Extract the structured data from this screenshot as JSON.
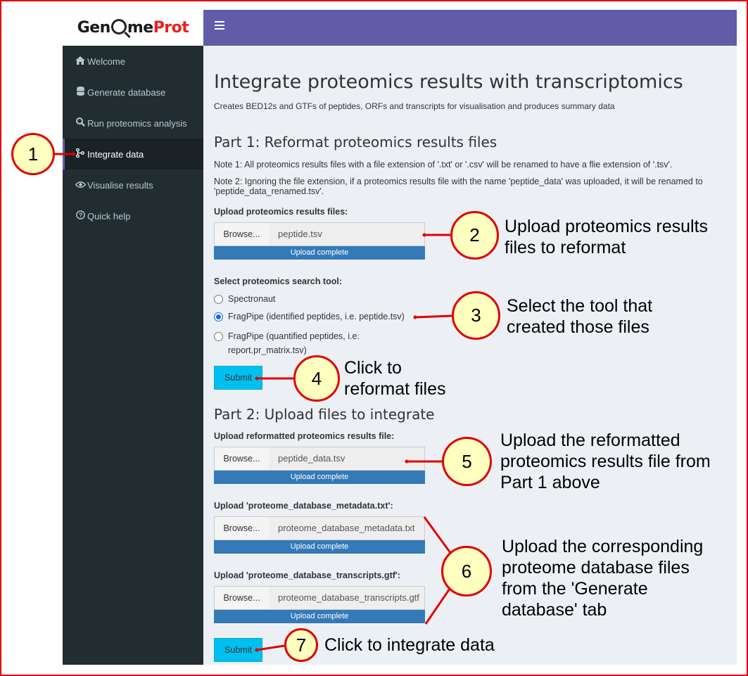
{
  "logo": {
    "part1": "Gen",
    "part2": "me",
    "part3": "Prot"
  },
  "sidebar": {
    "items": [
      {
        "label": "Welcome",
        "icon": "home-icon"
      },
      {
        "label": "Generate database",
        "icon": "database-icon"
      },
      {
        "label": "Run proteomics analysis",
        "icon": "search-icon"
      },
      {
        "label": "Integrate data",
        "icon": "code-fork-icon"
      },
      {
        "label": "Visualise results",
        "icon": "eye-icon"
      },
      {
        "label": "Quick help",
        "icon": "question-circle-icon"
      }
    ]
  },
  "main": {
    "title": "Integrate proteomics results with transcriptomics",
    "subtitle": "Creates BED12s and GTFs of peptides, ORFs and transcripts for visualisation and produces summary data",
    "part1": {
      "heading": "Part 1: Reformat proteomics results files",
      "note1": "Note 1: All proteomics results files with a file extension of '.txt' or '.csv' will be renamed to have a flie extension of '.tsv'.",
      "note2": "Note 2: Ignoring the file extension, if a proteomics results file with the name 'peptide_data' was uploaded, it will be renamed to 'peptide_data_renamed.tsv'.",
      "upload_label": "Upload proteomics results files:",
      "browse": "Browse...",
      "file": "peptide.tsv",
      "progress": "Upload complete",
      "tool_label": "Select proteomics search tool:",
      "options": [
        "Spectronaut",
        "FragPipe (identified peptides, i.e. peptide.tsv)",
        "FragPipe (quantified peptides, i.e. report.pr_matrix.tsv)"
      ],
      "submit": "Submit"
    },
    "part2": {
      "heading": "Part 2: Upload files to integrate",
      "upload1_label": "Upload reformatted proteomics results file:",
      "file1": "peptide_data.tsv",
      "upload2_label": "Upload 'proteome_database_metadata.txt':",
      "file2": "proteome_database_metadata.txt",
      "upload3_label": "Upload 'proteome_database_transcripts.gtf':",
      "file3": "proteome_database_transcripts.gtf",
      "browse": "Browse...",
      "progress": "Upload complete",
      "submit": "Submit"
    }
  },
  "annotations": [
    {
      "num": "1",
      "text": ""
    },
    {
      "num": "2",
      "text": "Upload proteomics results files to reformat"
    },
    {
      "num": "3",
      "text": "Select the tool that created those files"
    },
    {
      "num": "4",
      "text": "Click to reformat files"
    },
    {
      "num": "5",
      "text": "Upload the reformatted proteomics results file from Part 1 above"
    },
    {
      "num": "6",
      "text": "Upload the corresponding proteome database files from the 'Generate database' tab"
    },
    {
      "num": "7",
      "text": "Click to integrate data"
    }
  ],
  "colors": {
    "header": "#605ca8",
    "sidebar": "#222d32",
    "content_bg": "#ecf0f5",
    "annotation_red": "#e00000",
    "callout_fill": "#ffffc0"
  }
}
